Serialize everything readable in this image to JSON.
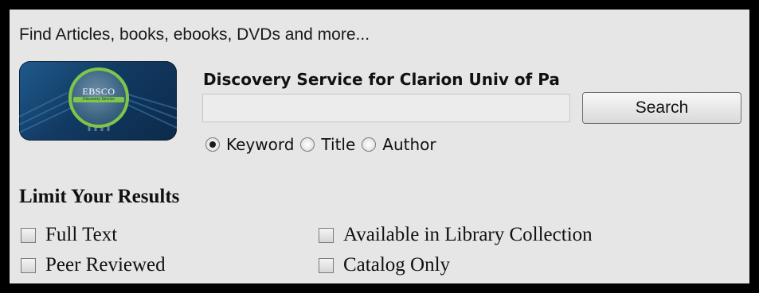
{
  "intro_text": "Find Articles, books, ebooks, DVDs and more...",
  "logo": {
    "brand": "EBSCO",
    "tagline": "Discovery Service"
  },
  "search": {
    "title": "Discovery Service for Clarion Univ of Pa",
    "value": "",
    "placeholder": "",
    "button_label": "Search",
    "options": [
      {
        "label": "Keyword",
        "checked": true
      },
      {
        "label": "Title",
        "checked": false
      },
      {
        "label": "Author",
        "checked": false
      }
    ]
  },
  "limits": {
    "heading": "Limit Your Results",
    "items": [
      {
        "label": "Full Text",
        "checked": false
      },
      {
        "label": "Peer Reviewed",
        "checked": false
      },
      {
        "label": "Available in Library Collection",
        "checked": false
      },
      {
        "label": "Catalog Only",
        "checked": false
      }
    ]
  },
  "colors": {
    "background": "#e6e6e6",
    "border": "#000000",
    "logo_blue": "#123a63",
    "logo_green": "#7ec64a"
  }
}
